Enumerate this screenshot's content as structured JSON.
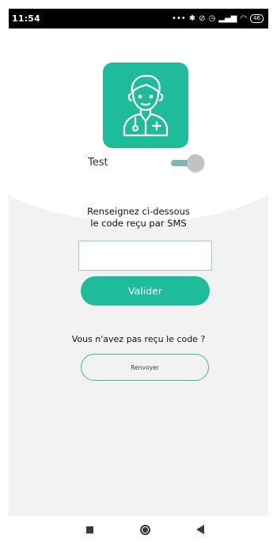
{
  "status_bar": {
    "time": "11:54",
    "battery": "46"
  },
  "toggle": {
    "label": "Test"
  },
  "instructions": {
    "line1": "Renseignez ci-dessous",
    "line2": "le code reçu par SMS"
  },
  "code_input": {
    "value": "",
    "placeholder": ""
  },
  "validate_button": {
    "label": "Valider"
  },
  "no_code_text": "Vous n'avez pas reçu le code ?",
  "resend_button": {
    "label": "Renvoyer"
  },
  "colors": {
    "accent": "#1fbc9c",
    "background": "#f2f2f2"
  }
}
